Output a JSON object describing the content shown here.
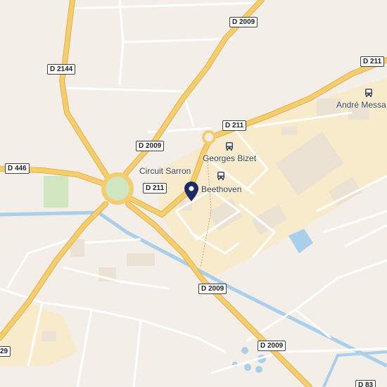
{
  "colors": {
    "background": "#f3eee8",
    "industrial_zone": "#f7ebcb",
    "major_road": "#f4cd6e",
    "major_road_casing": "#e2b24a",
    "minor_road": "#ffffff",
    "water": "#a9cfea",
    "park": "#cfe6c0",
    "marker": "#1d2b64"
  },
  "road_labels": {
    "d2009_top": "D 2009",
    "d211_right": "D 211",
    "d2144": "D 2144",
    "d211_mid": "D 211",
    "d2009_mid": "D 2009",
    "d446": "D 446",
    "d211_round": "D 211",
    "d2009_south": "D 2009",
    "d2009_bottom": "D 2009",
    "d83": "D 83",
    "left_edge": "29"
  },
  "places": {
    "andre_messager": "André Messa",
    "georges_bizet": "Georges Bizet",
    "circuit_sarron": "Circuit Sarron",
    "beethoven": "Beethoven"
  },
  "icons": {
    "bus_stop": "bus-stop-icon",
    "location_marker": "location-pin-icon"
  }
}
